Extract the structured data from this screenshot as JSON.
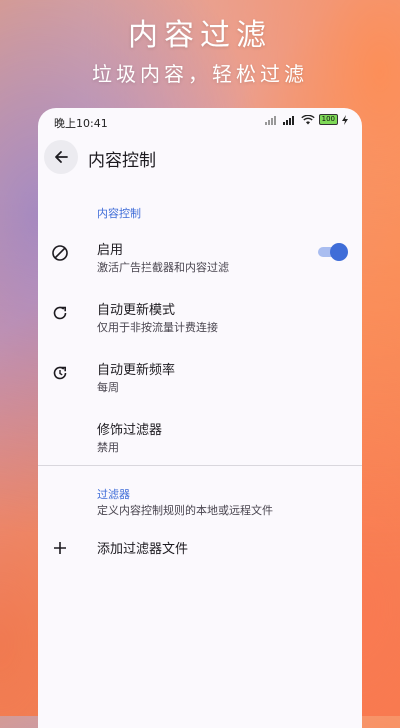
{
  "promo": {
    "headline": "内容过滤",
    "subline": "垃圾内容，轻松过滤"
  },
  "status_bar": {
    "time": "晚上10:41",
    "battery": "100"
  },
  "app_bar": {
    "title": "内容控制"
  },
  "sections": {
    "content_control": {
      "header": "内容控制",
      "items": [
        {
          "title": "启用",
          "subtitle": "激活广告拦截器和内容过滤",
          "icon": "block-icon",
          "toggle": true
        },
        {
          "title": "自动更新模式",
          "subtitle": "仅用于非按流量计费连接",
          "icon": "refresh-icon"
        },
        {
          "title": "自动更新频率",
          "subtitle": "每周",
          "icon": "history-icon"
        },
        {
          "title": "修饰过滤器",
          "subtitle": "禁用"
        }
      ]
    },
    "filters": {
      "header": "过滤器",
      "description": "定义内容控制规则的本地或远程文件",
      "add_label": "添加过滤器文件"
    }
  },
  "colors": {
    "accent": "#3f6dd8",
    "accent_light": "#a9bdf0",
    "surface": "#fbf9fd"
  }
}
